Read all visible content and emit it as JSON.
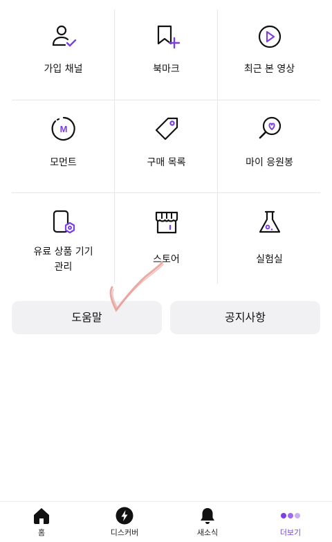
{
  "menu": {
    "items": [
      {
        "label": "가입 채널",
        "icon": "user-check-icon"
      },
      {
        "label": "북마크",
        "icon": "bookmark-plus-icon"
      },
      {
        "label": "최근 본 영상",
        "icon": "play-circle-icon"
      },
      {
        "label": "모먼트",
        "icon": "moment-m-icon"
      },
      {
        "label": "구매 목록",
        "icon": "price-tag-icon"
      },
      {
        "label": "마이 응원봉",
        "icon": "lightstick-heart-icon"
      },
      {
        "label_line1": "유료 상품 기기",
        "label_line2": "관리",
        "icon": "device-settings-icon"
      },
      {
        "label": "스토어",
        "icon": "store-icon"
      },
      {
        "label": "실험실",
        "icon": "flask-icon"
      }
    ]
  },
  "buttons": {
    "help": "도움말",
    "notice": "공지사항"
  },
  "tabbar": {
    "tabs": [
      {
        "label": "홈",
        "icon": "home-icon"
      },
      {
        "label": "디스커버",
        "icon": "lightning-icon"
      },
      {
        "label": "새소식",
        "icon": "bell-icon"
      },
      {
        "label": "더보기",
        "icon": "more-dots-icon",
        "active": true
      }
    ]
  },
  "colors": {
    "accent": "#7b3fe4",
    "button_bg": "#f1f1f3",
    "divider": "#e6e6e6",
    "scribble": "#e89a93"
  }
}
